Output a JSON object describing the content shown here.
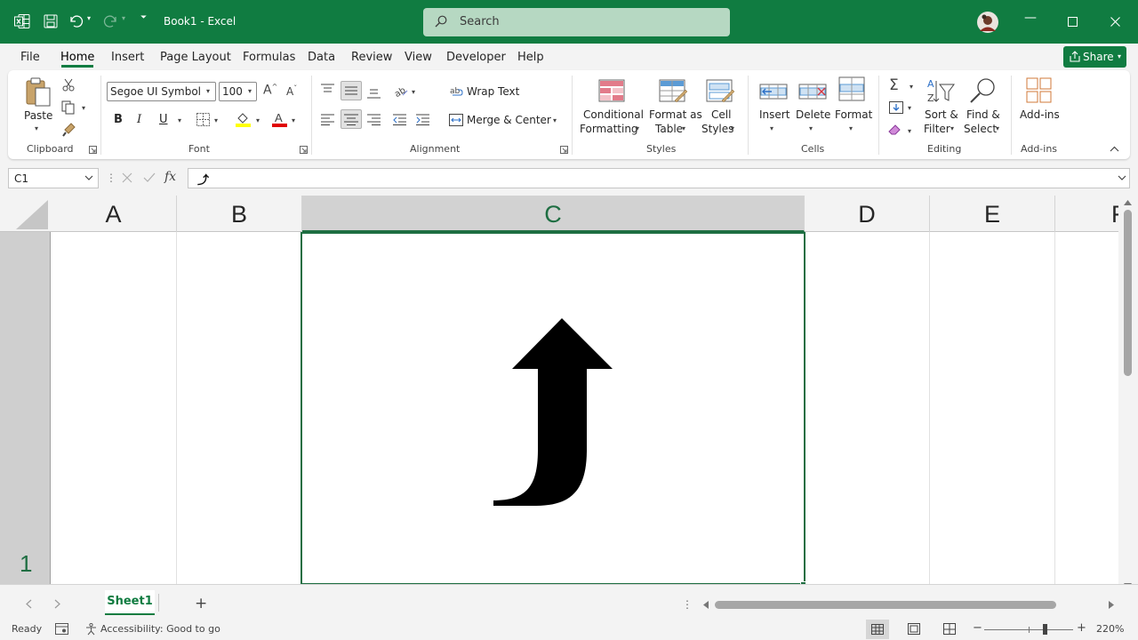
{
  "app": {
    "title": "Book1 - Excel"
  },
  "search": {
    "placeholder": "Search"
  },
  "tabs": [
    "File",
    "Home",
    "Insert",
    "Page Layout",
    "Formulas",
    "Data",
    "Review",
    "View",
    "Developer",
    "Help"
  ],
  "active_tab": "Home",
  "share": {
    "label": "Share"
  },
  "ribbon": {
    "clipboard": {
      "paste": "Paste",
      "group": "Clipboard"
    },
    "font": {
      "name": "Segoe UI Symbol",
      "size": "100",
      "bold": "B",
      "italic": "I",
      "underline": "U",
      "group": "Font"
    },
    "alignment": {
      "wrap_text": "Wrap Text",
      "merge_center": "Merge & Center",
      "group": "Alignment"
    },
    "styles": {
      "conditional_formatting_1": "Conditional",
      "conditional_formatting_2": "Formatting",
      "format_table_1": "Format as",
      "format_table_2": "Table",
      "cell_styles_1": "Cell",
      "cell_styles_2": "Styles",
      "group": "Styles"
    },
    "cells": {
      "insert": "Insert",
      "delete": "Delete",
      "format": "Format",
      "group": "Cells"
    },
    "editing": {
      "sort_1": "Sort &",
      "sort_2": "Filter",
      "find_1": "Find &",
      "find_2": "Select",
      "group": "Editing"
    },
    "addins": {
      "label": "Add-ins",
      "group": "Add-ins"
    }
  },
  "formula_bar": {
    "name_box": "C1",
    "fx": "fx",
    "content": "⤴"
  },
  "grid": {
    "columns": [
      "A",
      "B",
      "C",
      "D",
      "E",
      "F"
    ],
    "selected_column": "C",
    "rows": [
      "1"
    ],
    "active_cell": "C1",
    "cell_glyph": "⤴"
  },
  "sheets": {
    "tabs": [
      "Sheet1"
    ],
    "active": "Sheet1",
    "add": "+"
  },
  "status": {
    "ready": "Ready",
    "accessibility": "Accessibility: Good to go",
    "zoom": "220%"
  },
  "colors": {
    "brand": "#107c41",
    "selection": "#1e6e42"
  }
}
